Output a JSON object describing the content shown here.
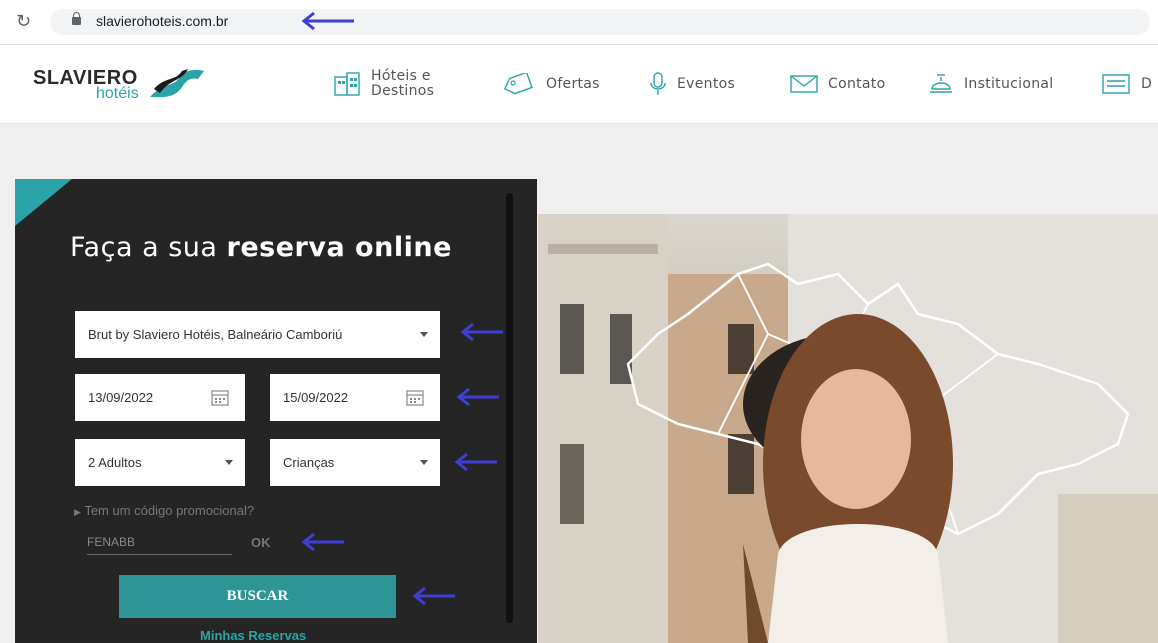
{
  "browser": {
    "url": "slavierohoteis.com.br"
  },
  "brand": {
    "name": "SLAVIERO",
    "sub": "hotéis"
  },
  "nav": {
    "items": [
      {
        "label": "Hóteis e\nDestinos",
        "icon": "building-icon"
      },
      {
        "label": "Ofertas",
        "icon": "tag-icon"
      },
      {
        "label": "Eventos",
        "icon": "microphone-icon"
      },
      {
        "label": "Contato",
        "icon": "envelope-icon"
      },
      {
        "label": "Institucional",
        "icon": "bell-icon"
      },
      {
        "label": "D",
        "icon": "document-icon"
      }
    ]
  },
  "booking": {
    "heading_light": "Faça a sua ",
    "heading_bold": "reserva online",
    "hotel": "Brut by Slaviero Hotéis, Balneário Camboriú",
    "checkin": "13/09/2022",
    "checkout": "15/09/2022",
    "adults": "2 Adultos",
    "children": "Crianças",
    "promo_toggle": "Tem um código promocional?",
    "promo_code": "FENABB",
    "ok_label": "OK",
    "search_label": "BUSCAR",
    "my_bookings": "Minhas Reservas"
  },
  "colors": {
    "accent": "#2aa4a8",
    "panel": "#252525",
    "annotation_arrow": "#3f3fd6"
  }
}
